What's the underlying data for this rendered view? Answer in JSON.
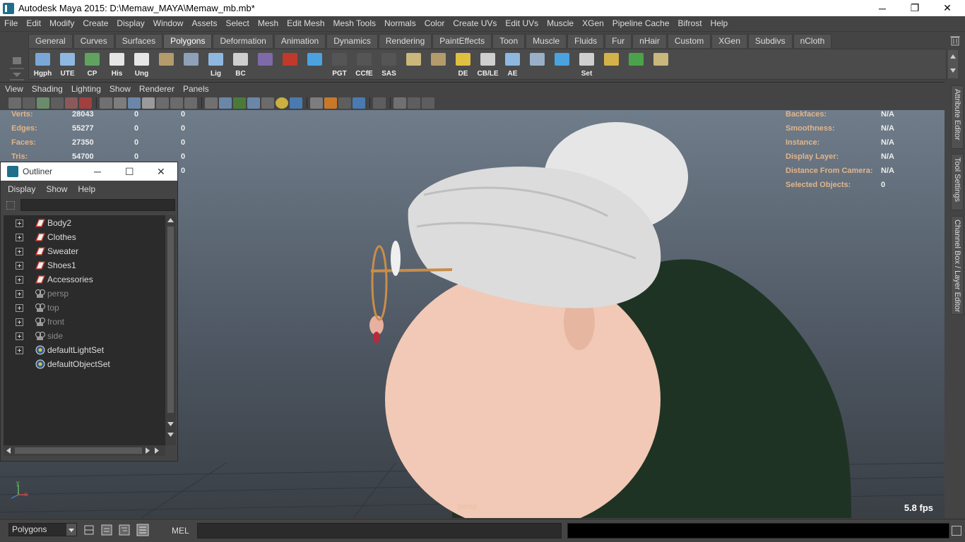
{
  "window": {
    "title": "Autodesk Maya 2015: D:\\Memaw_MAYA\\Memaw_mb.mb*",
    "minimize": "─",
    "maximize": "❐",
    "close": "✕"
  },
  "menubar": [
    "File",
    "Edit",
    "Modify",
    "Create",
    "Display",
    "Window",
    "Assets",
    "Select",
    "Mesh",
    "Edit Mesh",
    "Mesh Tools",
    "Normals",
    "Color",
    "Create UVs",
    "Edit UVs",
    "Muscle",
    "XGen",
    "Pipeline Cache",
    "Bifrost",
    "Help"
  ],
  "shelf": {
    "tabs": [
      "General",
      "Curves",
      "Surfaces",
      "Polygons",
      "Deformation",
      "Animation",
      "Dynamics",
      "Rendering",
      "PaintEffects",
      "Toon",
      "Muscle",
      "Fluids",
      "Fur",
      "nHair",
      "Custom",
      "XGen",
      "Subdivs",
      "nCloth"
    ],
    "active_tab": "Polygons",
    "icons": [
      {
        "label": "Hgph",
        "icon": "hypergraph-icon",
        "color": "#7aa7d8"
      },
      {
        "label": "UTE",
        "icon": "uv-texture-editor-icon",
        "color": "#8fb8e0"
      },
      {
        "label": "CP",
        "icon": "axes-icon",
        "color": "#5fa35f"
      },
      {
        "label": "His",
        "icon": "history-icon",
        "color": "#e6e6e6"
      },
      {
        "label": "Ung",
        "icon": "ungroup-icon",
        "color": "#e6e6e6"
      },
      {
        "label": "",
        "icon": "freeze-icon",
        "color": "#b59b6c"
      },
      {
        "label": "",
        "icon": "globe-cursor-icon",
        "color": "#8fa1b8"
      },
      {
        "label": "Lig",
        "icon": "light-icon",
        "color": "#8fb8e0"
      },
      {
        "label": "BC",
        "icon": "eye-icon",
        "color": "#cfcfcf"
      },
      {
        "label": "",
        "icon": "manipulator-icon",
        "color": "#7e6aa8"
      },
      {
        "label": "",
        "icon": "camera-icon",
        "color": "#c0392b"
      },
      {
        "label": "",
        "icon": "curve-icon",
        "color": "#4aa3df"
      },
      {
        "label": "PGT",
        "icon": "pgt-icon",
        "color": "#555555"
      },
      {
        "label": "CCfE",
        "icon": "ccfe-icon",
        "color": "#555555"
      },
      {
        "label": "SAS",
        "icon": "sas-icon",
        "color": "#555555"
      },
      {
        "label": "",
        "icon": "plane-icon",
        "color": "#c9b77c"
      },
      {
        "label": "",
        "icon": "uv-plane-icon",
        "color": "#b59b6c"
      },
      {
        "label": "DE",
        "icon": "sun-icon",
        "color": "#e0c040"
      },
      {
        "label": "CB/LE",
        "icon": "eye-icon",
        "color": "#cfcfcf"
      },
      {
        "label": "AE",
        "icon": "attribute-editor-icon",
        "color": "#8fb8e0"
      },
      {
        "label": "",
        "icon": "spotlight-icon",
        "color": "#9ab0c8"
      },
      {
        "label": "",
        "icon": "blend-curve-icon",
        "color": "#4aa3df"
      },
      {
        "label": "Set",
        "icon": "key-icon",
        "color": "#cfcfcf"
      },
      {
        "label": "",
        "icon": "target-icon",
        "color": "#d4b24a"
      },
      {
        "label": "",
        "icon": "rgb-circle-icon",
        "color": "#4aa34a"
      },
      {
        "label": "",
        "icon": "layer-plane-icon",
        "color": "#c9b77c"
      }
    ]
  },
  "panel": {
    "menu": [
      "View",
      "Shading",
      "Lighting",
      "Show",
      "Renderer",
      "Panels"
    ]
  },
  "hud": {
    "left": [
      {
        "label": "Verts:",
        "v1": "28043",
        "v2": "0",
        "v3": "0"
      },
      {
        "label": "Edges:",
        "v1": "55277",
        "v2": "0",
        "v3": "0"
      },
      {
        "label": "Faces:",
        "v1": "27350",
        "v2": "0",
        "v3": "0"
      },
      {
        "label": "Tris:",
        "v1": "54700",
        "v2": "0",
        "v3": "0"
      },
      {
        "label": "",
        "v1": "",
        "v2": "",
        "v3": "0"
      }
    ],
    "right": [
      {
        "label": "Backfaces:",
        "value": "N/A"
      },
      {
        "label": "Smoothness:",
        "value": "N/A"
      },
      {
        "label": "Instance:",
        "value": "N/A"
      },
      {
        "label": "Display Layer:",
        "value": "N/A"
      },
      {
        "label": "Distance From Camera:",
        "value": "N/A"
      },
      {
        "label": "Selected Objects:",
        "value": "0"
      }
    ],
    "camera": "persp",
    "fps": "5.8 fps",
    "axis_y": "y",
    "axis_x": "x"
  },
  "outliner": {
    "title": "Outliner",
    "menu": [
      "Display",
      "Show",
      "Help"
    ],
    "search_value": "",
    "items": [
      {
        "label": "Body2",
        "icon": "mesh-transform-icon",
        "expandable": true,
        "dim": false
      },
      {
        "label": "Clothes",
        "icon": "mesh-transform-icon",
        "expandable": true,
        "dim": false
      },
      {
        "label": "Sweater",
        "icon": "mesh-transform-icon",
        "expandable": true,
        "dim": false
      },
      {
        "label": "Shoes1",
        "icon": "mesh-transform-icon",
        "expandable": true,
        "dim": false
      },
      {
        "label": "Accessories",
        "icon": "mesh-transform-icon",
        "expandable": true,
        "dim": false
      },
      {
        "label": "persp",
        "icon": "camera-icon",
        "expandable": true,
        "dim": true
      },
      {
        "label": "top",
        "icon": "camera-icon",
        "expandable": true,
        "dim": true
      },
      {
        "label": "front",
        "icon": "camera-icon",
        "expandable": true,
        "dim": true
      },
      {
        "label": "side",
        "icon": "camera-icon",
        "expandable": true,
        "dim": true
      },
      {
        "label": "defaultLightSet",
        "icon": "set-icon",
        "expandable": true,
        "dim": false
      },
      {
        "label": "defaultObjectSet",
        "icon": "set-icon",
        "expandable": false,
        "dim": false
      }
    ]
  },
  "sidetabs": [
    "Attribute Editor",
    "Tool Settings",
    "Channel Box / Layer Editor"
  ],
  "commandline": {
    "mode": "Polygons",
    "mel_label": "MEL",
    "input_value": ""
  }
}
